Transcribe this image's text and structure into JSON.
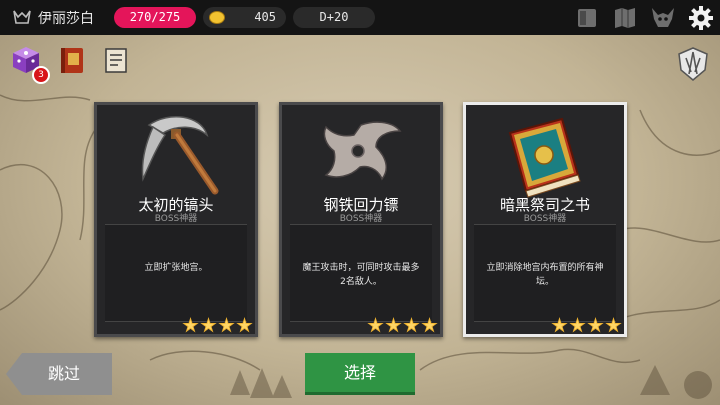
{
  "top_bar": {
    "player_name": "伊丽莎白",
    "hp": "270/275",
    "gold": "405",
    "day": "D+20",
    "icons": [
      "book-icon",
      "map-icon",
      "demon-head-icon",
      "settings-gear-icon"
    ]
  },
  "left_items": [
    {
      "icon": "purple-dice-cube-icon",
      "badge": "3"
    },
    {
      "icon": "red-spellbook-icon"
    },
    {
      "icon": "scroll-icon"
    }
  ],
  "right_icon": "wing-emblem-icon",
  "cards": [
    {
      "title": "太初的镐头",
      "subtitle": "BOSS神器",
      "description": "立即扩张地宫。",
      "stars": 4,
      "selected": false,
      "art": "pickaxe"
    },
    {
      "title": "钢铁回力镖",
      "subtitle": "BOSS神器",
      "description": "魔王攻击时，可同时攻击最多2名敌人。",
      "stars": 4,
      "selected": false,
      "art": "shuriken-boomerang"
    },
    {
      "title": "暗黑祭司之书",
      "subtitle": "BOSS神器",
      "description": "立即消除地宫内布置的所有神坛。",
      "stars": 4,
      "selected": true,
      "art": "ornate-red-book"
    }
  ],
  "buttons": {
    "skip": "跳过",
    "select": "选择"
  },
  "colors": {
    "hp_pill": "#e4155a",
    "select_button": "#2f9444",
    "skip_button": "#8f8f8f",
    "star": "#f0b431"
  }
}
